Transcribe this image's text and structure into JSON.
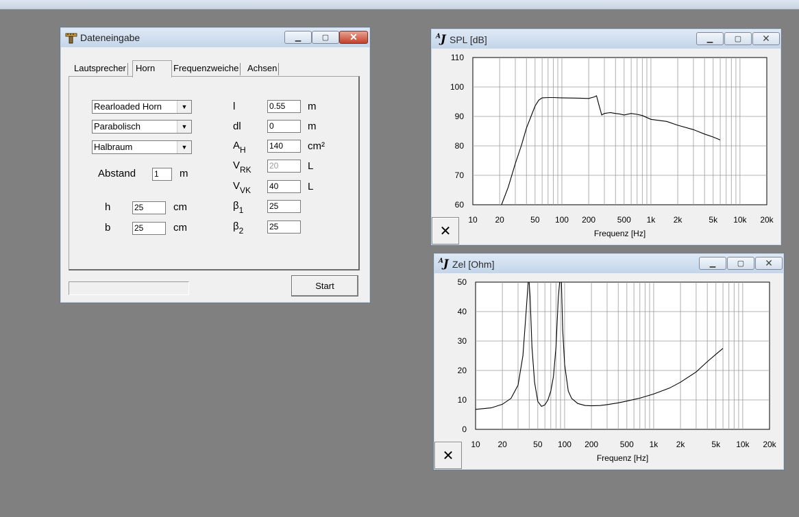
{
  "dialog": {
    "title": "Dateneingabe",
    "tabs": [
      {
        "label": "Lautsprecher",
        "active": false
      },
      {
        "label": "Horn",
        "active": true
      },
      {
        "label": "Frequenzweiche",
        "active": false
      },
      {
        "label": "Achsen",
        "active": false
      }
    ],
    "selects": {
      "horn_type": "Rearloaded Horn",
      "profile": "Parabolisch",
      "space": "Halbraum"
    },
    "abstand": {
      "label": "Abstand",
      "value": "1",
      "unit": "m"
    },
    "h": {
      "label": "h",
      "value": "25",
      "unit": "cm"
    },
    "b": {
      "label": "b",
      "value": "25",
      "unit": "cm"
    },
    "l": {
      "label": "l",
      "value": "0.55",
      "unit": "m"
    },
    "dl": {
      "label": "dl",
      "value": "0",
      "unit": "m"
    },
    "ah": {
      "label": "A",
      "sub": "H",
      "value": "140",
      "unit": "cm²"
    },
    "vrk": {
      "label": "V",
      "sub": "RK",
      "value": "20",
      "unit": "L"
    },
    "vvk": {
      "label": "V",
      "sub": "VK",
      "value": "40",
      "unit": "L"
    },
    "beta1": {
      "label": "β",
      "sub": "1",
      "value": "25"
    },
    "beta2": {
      "label": "β",
      "sub": "2",
      "value": "25"
    },
    "start_label": "Start"
  },
  "spl_window": {
    "icon": "AJ",
    "title": "SPL [dB]"
  },
  "zel_window": {
    "icon": "AJ",
    "title": "Zel [Ohm]"
  },
  "colors": {
    "title_gradient_top": "#dfe9f5",
    "close_red": "#c4402a",
    "plot_bg": "#ffffff"
  },
  "chart_data": [
    {
      "type": "line",
      "title": "SPL [dB]",
      "xlabel": "Frequenz [Hz]",
      "ylabel": "",
      "xscale": "log",
      "xlim": [
        10,
        20000
      ],
      "ylim": [
        60,
        110
      ],
      "xticks": [
        10,
        20,
        50,
        100,
        200,
        500,
        1000,
        2000,
        5000,
        10000,
        20000
      ],
      "xticklabels": [
        "10",
        "20",
        "50",
        "100",
        "200",
        "500",
        "1k",
        "2k",
        "5k",
        "10k",
        "20k"
      ],
      "yticks": [
        60,
        70,
        80,
        90,
        100,
        110
      ],
      "yticklabels": [
        "60",
        "70",
        "80",
        "90",
        "100",
        "110"
      ],
      "grid": true,
      "series": [
        {
          "x": [
            21,
            25,
            30,
            35,
            40,
            45,
            50,
            55,
            60,
            70,
            80,
            100,
            150,
            200,
            230,
            245,
            260,
            280,
            300,
            350,
            400,
            450,
            500,
            600,
            700,
            800,
            1000,
            1500,
            2000,
            3000,
            4000,
            5000,
            6000
          ],
          "y": [
            60,
            66,
            74,
            80,
            86,
            90,
            93.5,
            95.5,
            96.3,
            96.4,
            96.4,
            96.3,
            96.2,
            96.1,
            96.6,
            97,
            94,
            90.5,
            91,
            91.3,
            91,
            90.8,
            90.5,
            91,
            90.7,
            90.3,
            89,
            88.3,
            87,
            85.5,
            84,
            83,
            82
          ]
        }
      ]
    },
    {
      "type": "line",
      "title": "Zel [Ohm]",
      "xlabel": "Frequenz [Hz]",
      "ylabel": "",
      "xscale": "log",
      "xlim": [
        10,
        20000
      ],
      "ylim": [
        0,
        50
      ],
      "xticks": [
        10,
        20,
        50,
        100,
        200,
        500,
        1000,
        2000,
        5000,
        10000,
        20000
      ],
      "xticklabels": [
        "10",
        "20",
        "50",
        "100",
        "200",
        "500",
        "1k",
        "2k",
        "5k",
        "10k",
        "20k"
      ],
      "yticks": [
        0,
        10,
        20,
        30,
        40,
        50
      ],
      "yticklabels": [
        "0",
        "10",
        "20",
        "30",
        "40",
        "50"
      ],
      "grid": true,
      "series": [
        {
          "x": [
            10,
            15,
            20,
            25,
            30,
            34,
            37,
            39,
            40,
            41,
            43,
            46,
            50,
            55,
            60,
            65,
            70,
            75,
            80,
            85,
            88,
            90,
            92,
            95,
            100,
            110,
            120,
            140,
            170,
            200,
            250,
            300,
            400,
            500,
            700,
            1000,
            1500,
            2000,
            3000,
            4000,
            5000,
            6000
          ],
          "y": [
            6.8,
            7.3,
            8.5,
            10.5,
            15,
            25,
            40,
            50,
            50,
            45,
            28,
            16,
            9.5,
            7.8,
            8.3,
            10,
            13,
            18,
            28,
            45,
            50,
            50,
            50,
            34,
            22,
            13,
            10.5,
            8.8,
            8.1,
            8,
            8.1,
            8.4,
            9,
            9.6,
            10.6,
            12,
            14,
            16,
            19.5,
            23,
            25.5,
            27.5
          ]
        }
      ]
    }
  ]
}
